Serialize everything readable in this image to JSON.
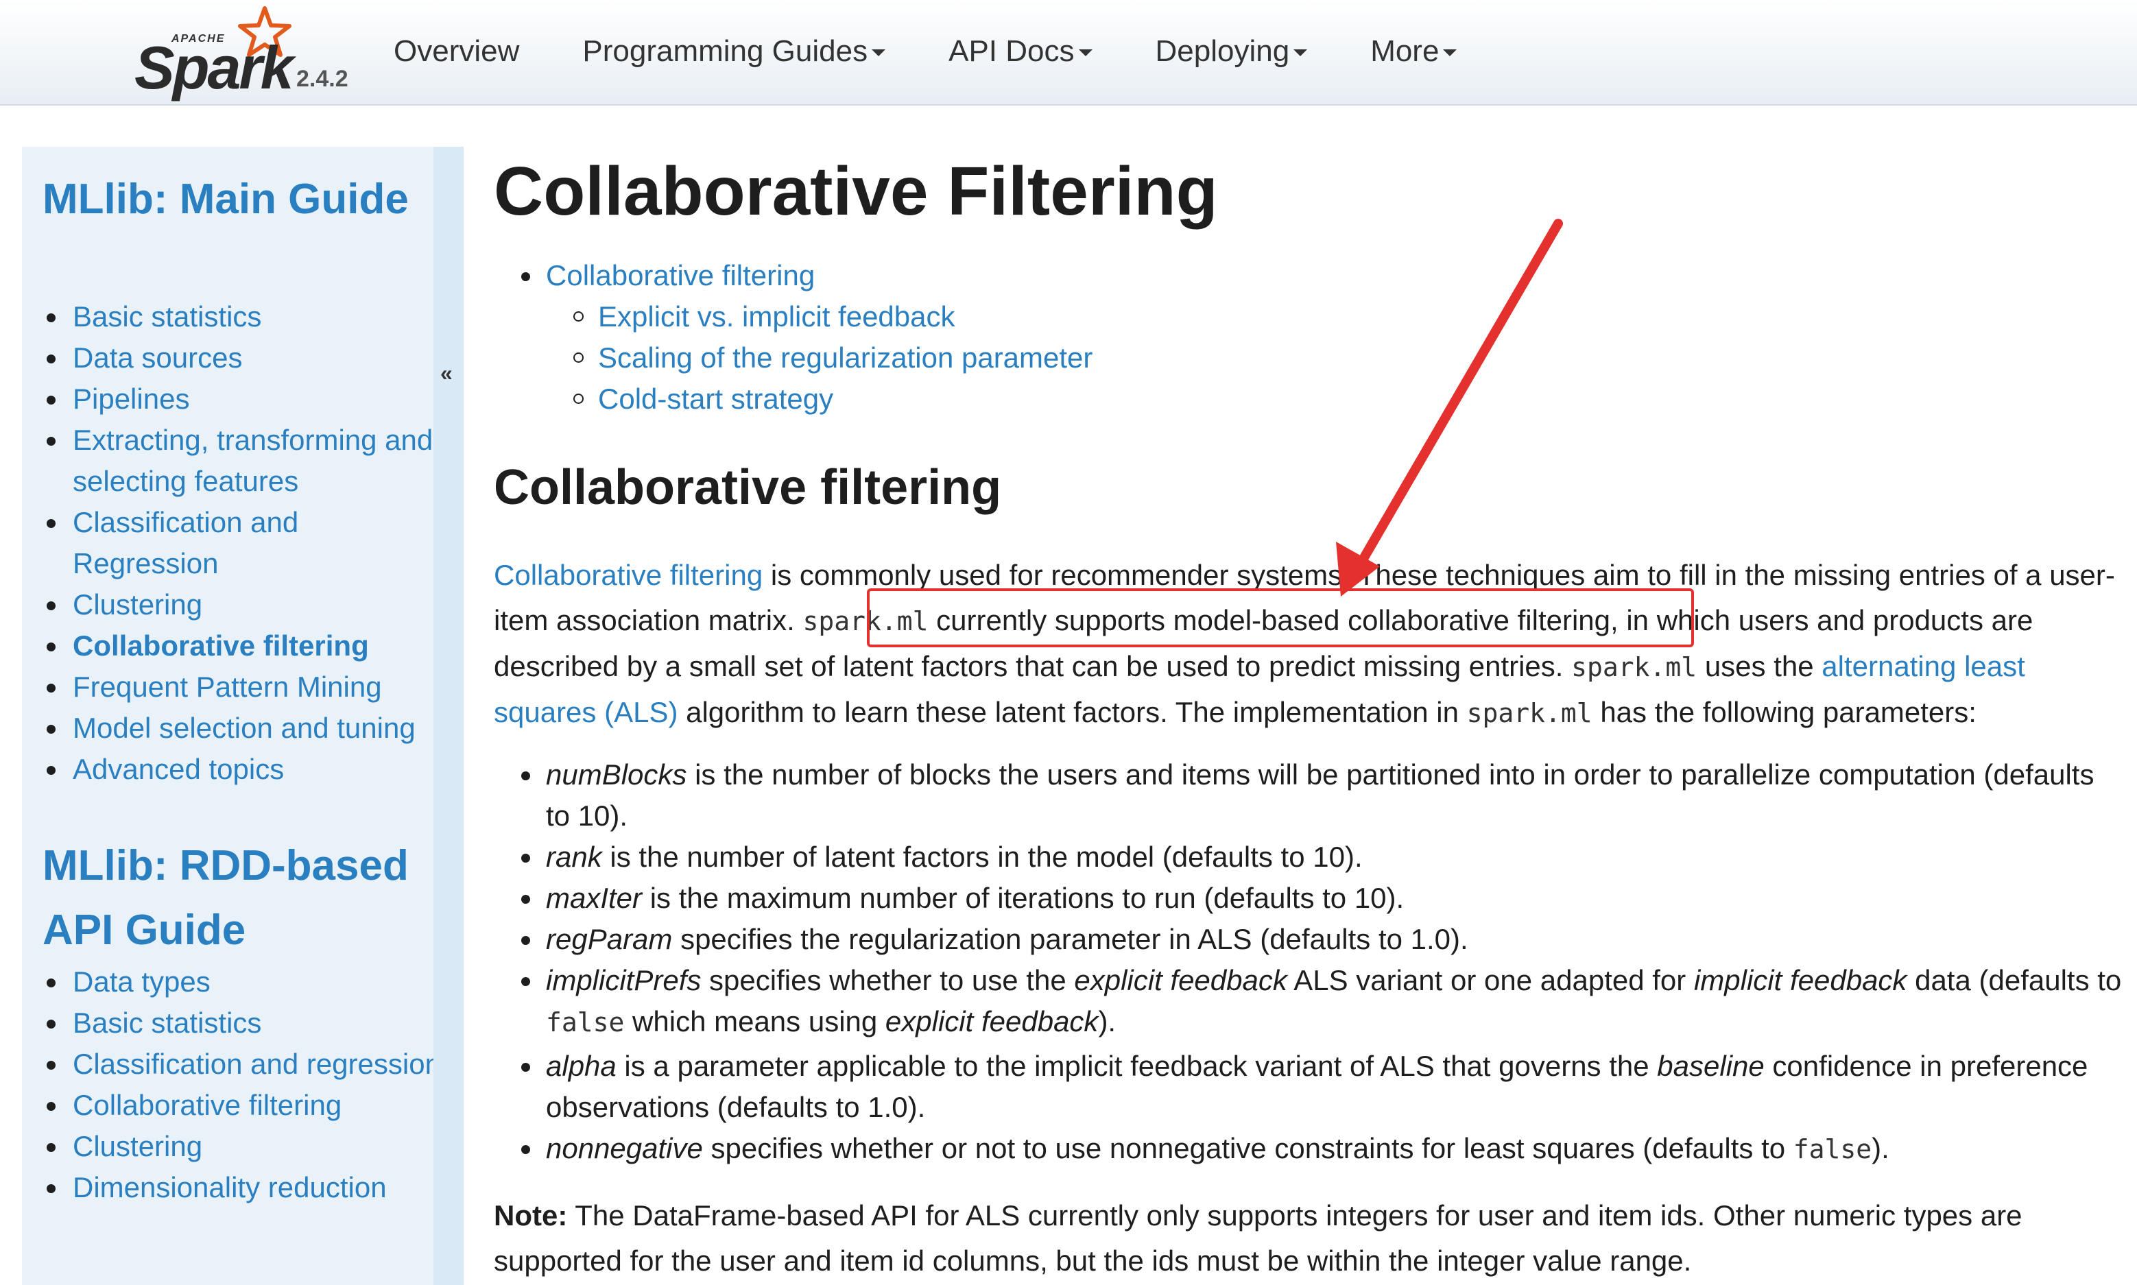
{
  "brand": {
    "apache": "APACHE",
    "name": "Spark",
    "version": "2.4.2"
  },
  "nav": [
    {
      "label": "Overview",
      "dropdown": false
    },
    {
      "label": "Programming Guides",
      "dropdown": true
    },
    {
      "label": "API Docs",
      "dropdown": true
    },
    {
      "label": "Deploying",
      "dropdown": true
    },
    {
      "label": "More",
      "dropdown": true
    }
  ],
  "sidebar": {
    "toggle": "«",
    "heading1": "MLlib: Main Guide",
    "list1": [
      "Basic statistics",
      "Data sources",
      "Pipelines",
      "Extracting, transforming and selecting features",
      "Classification and Regression",
      "Clustering",
      "Collaborative filtering",
      "Frequent Pattern Mining",
      "Model selection and tuning",
      "Advanced topics"
    ],
    "active_item": "Collaborative filtering",
    "heading2": "MLlib: RDD-based API Guide",
    "list2": [
      "Data types",
      "Basic statistics",
      "Classification and regression",
      "Collaborative filtering",
      "Clustering",
      "Dimensionality reduction"
    ]
  },
  "main": {
    "title": "Collaborative Filtering",
    "toc": {
      "top": "Collaborative filtering",
      "sub": [
        "Explicit vs. implicit feedback",
        "Scaling of the regularization parameter",
        "Cold-start strategy"
      ]
    },
    "section_title": "Collaborative filtering",
    "para": {
      "link1": "Collaborative filtering",
      "t1": " is commonly used for recommender systems. These techniques aim to fill in the missing entries of a user-item association matrix. ",
      "code1": "spark.ml",
      "t2": " currently supports model-based collaborative filtering,",
      "t3": " in which users and products are described by a small set of latent factors that can be used to predict missing entries. ",
      "code2": "spark.ml",
      "t4": " uses the ",
      "link2": "alternating least squares (ALS)",
      "t5": " algorithm to learn these latent factors. The implementation in ",
      "code3": "spark.ml",
      "t6": " has the following parameters:"
    },
    "params": {
      "p1_term": "numBlocks",
      "p1_text": " is the number of blocks the users and items will be partitioned into in order to parallelize computation (defaults to 10).",
      "p2_term": "rank",
      "p2_text": " is the number of latent factors in the model (defaults to 10).",
      "p3_term": "maxIter",
      "p3_text": " is the maximum number of iterations to run (defaults to 10).",
      "p4_term": "regParam",
      "p4_text": " specifies the regularization parameter in ALS (defaults to 1.0).",
      "p5_term": "implicitPrefs",
      "p5_t1": " specifies whether to use the ",
      "p5_i1": "explicit feedback",
      "p5_t2": " ALS variant or one adapted for ",
      "p5_i2": "implicit feedback",
      "p5_t3": " data (defaults to ",
      "p5_code": "false",
      "p5_t4": " which means using ",
      "p5_i3": "explicit feedback",
      "p5_t5": ").",
      "p6_term": "alpha",
      "p6_t1": " is a parameter applicable to the implicit feedback variant of ALS that governs the ",
      "p6_i1": "baseline",
      "p6_t2": " confidence in preference observations (defaults to 1.0).",
      "p7_term": "nonnegative",
      "p7_t1": " specifies whether or not to use nonnegative constraints for least squares (defaults to ",
      "p7_code": "false",
      "p7_t2": ")."
    },
    "note": {
      "label": "Note:",
      "text": " The DataFrame-based API for ALS currently only supports integers for user and item ids. Other numeric types are supported for the user and item id columns, but the ids must be within the integer value range."
    }
  },
  "colors": {
    "link": "#2a7fc1",
    "annotation": "#e5312d",
    "sidebar_bg": "#e9f2f9"
  }
}
